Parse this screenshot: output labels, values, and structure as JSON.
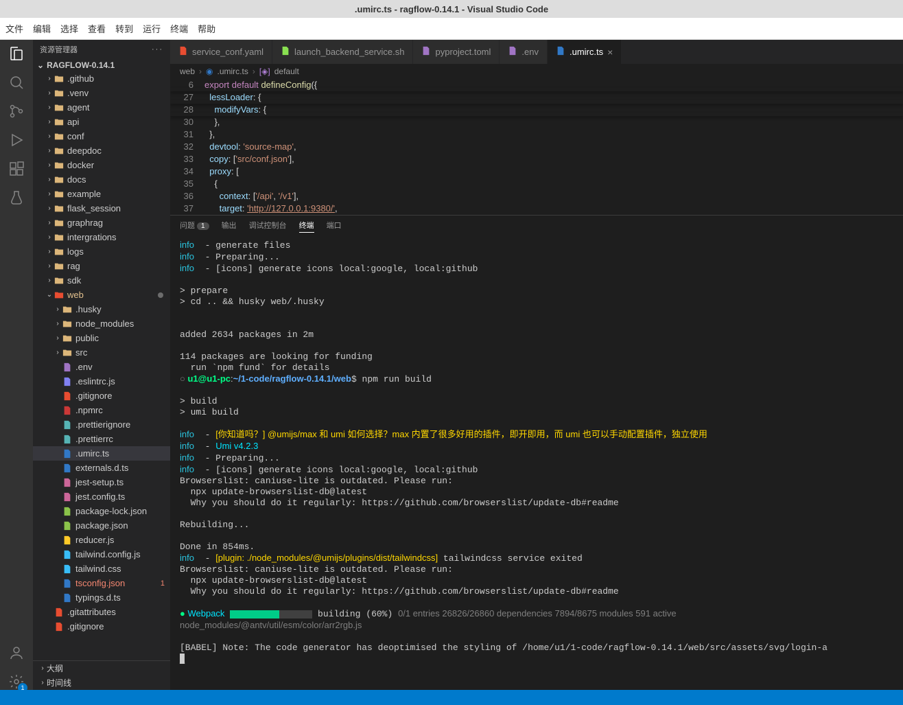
{
  "title": ".umirc.ts - ragflow-0.14.1 - Visual Studio Code",
  "menu": [
    "文件",
    "编辑",
    "选择",
    "查看",
    "转到",
    "运行",
    "终端",
    "帮助"
  ],
  "sidebar": {
    "title": "资源管理器",
    "root": "RAGFLOW-0.14.1",
    "folders": [
      ".github",
      ".venv",
      "agent",
      "api",
      "conf",
      "deepdoc",
      "docker",
      "docs",
      "example",
      "flask_session",
      "graphrag",
      "intergrations",
      "logs",
      "rag",
      "sdk"
    ],
    "web": "web",
    "webFolders": [
      ".husky",
      "node_modules",
      "public",
      "src"
    ],
    "webFiles": [
      {
        "n": ".env",
        "c": "#a074c4"
      },
      {
        "n": ".eslintrc.js",
        "c": "#8080f2"
      },
      {
        "n": ".gitignore",
        "c": "#e84d31"
      },
      {
        "n": ".npmrc",
        "c": "#cb3837"
      },
      {
        "n": ".prettierignore",
        "c": "#56b3b4"
      },
      {
        "n": ".prettierrc",
        "c": "#56b3b4"
      },
      {
        "n": ".umirc.ts",
        "c": "#3178c6",
        "sel": true
      },
      {
        "n": "externals.d.ts",
        "c": "#3178c6"
      },
      {
        "n": "jest-setup.ts",
        "c": "#cc6699"
      },
      {
        "n": "jest.config.ts",
        "c": "#cc6699"
      },
      {
        "n": "package-lock.json",
        "c": "#8bc34a"
      },
      {
        "n": "package.json",
        "c": "#8bc34a"
      },
      {
        "n": "reducer.js",
        "c": "#ffca28"
      },
      {
        "n": "tailwind.config.js",
        "c": "#38bdf8"
      },
      {
        "n": "tailwind.css",
        "c": "#38bdf8"
      },
      {
        "n": "tsconfig.json",
        "c": "#3178c6",
        "err": true,
        "badge": "1"
      },
      {
        "n": "typings.d.ts",
        "c": "#3178c6"
      }
    ],
    "rootFiles": [
      {
        "n": ".gitattributes",
        "c": "#e84d31"
      },
      {
        "n": ".gitignore",
        "c": "#e84d31"
      }
    ],
    "outline": "大纲",
    "timeline": "时间线"
  },
  "tabs": [
    {
      "n": "service_conf.yaml",
      "c": "#e84d31"
    },
    {
      "n": "launch_backend_service.sh",
      "c": "#89e051"
    },
    {
      "n": "pyproject.toml",
      "c": "#a074c4"
    },
    {
      "n": ".env",
      "c": "#a074c4"
    },
    {
      "n": ".umirc.ts",
      "c": "#3178c6",
      "active": true
    }
  ],
  "breadcrumb": {
    "a": "web",
    "b": ".umirc.ts",
    "c": "default"
  },
  "code": [
    {
      "n": 6,
      "t": "export default defineConfig({",
      "cls": "l6"
    },
    {
      "n": 27,
      "t": "  lessLoader: {",
      "cls": "l27"
    },
    {
      "n": 28,
      "t": "    modifyVars: {",
      "cls": "l28"
    },
    {
      "n": 30,
      "t": "    },",
      "cls": "pun"
    },
    {
      "n": 31,
      "t": "  },",
      "cls": "pun"
    },
    {
      "n": 32,
      "t": "  devtool: 'source-map',",
      "cls": "l32"
    },
    {
      "n": 33,
      "t": "  copy: ['src/conf.json'],",
      "cls": "l33"
    },
    {
      "n": 34,
      "t": "  proxy: [",
      "cls": "l34"
    },
    {
      "n": 35,
      "t": "    {",
      "cls": "pun"
    },
    {
      "n": 36,
      "t": "      context: ['/api', '/v1'],",
      "cls": "l36"
    },
    {
      "n": 37,
      "t": "      target: 'http://127.0.0.1:9380/',",
      "cls": "l37"
    }
  ],
  "panel": {
    "tabs": {
      "problems": "问题",
      "count": "1",
      "output": "输出",
      "debug": "调试控制台",
      "terminal": "终端",
      "ports": "端口"
    }
  },
  "term": {
    "l1": "info  - generate files",
    "l2": "info  - Preparing...",
    "l3": "info  - [icons] generate icons local:google, local:github",
    "l4": "> prepare",
    "l5": "> cd .. && husky web/.husky",
    "l6": "added 2634 packages in 2m",
    "l7": "114 packages are looking for funding",
    "l8": "  run `npm fund` for details",
    "prompt": {
      "user": "u1@u1-pc",
      "sep": ":",
      "path": "~/1-code/ragflow-0.14.1/web",
      "cmd": "$ npm run build"
    },
    "l9": "> build",
    "l10": "> umi build",
    "l11": "info  - [你知道吗？] @umijs/max 和 umi 如何选择？max 内置了很多好用的插件，即开即用，而 umi 也可以手动配置插件，独立使用",
    "l12": "info  - Umi v4.2.3",
    "l13": "info  - Preparing...",
    "l14": "info  - [icons] generate icons local:google, local:github",
    "l15": "Browserslist: caniuse-lite is outdated. Please run:",
    "l16": "  npx update-browserslist-db@latest",
    "l17": "  Why you should do it regularly: https://github.com/browserslist/update-db#readme",
    "l18": "Rebuilding...",
    "l19": "Done in 854ms.",
    "l20": "info  - [plugin: ./node_modules/@umijs/plugins/dist/tailwindcss] tailwindcss service exited",
    "l21": "Browserslist: caniuse-lite is outdated. Please run:",
    "l22": "  npx update-browserslist-db@latest",
    "l23": "  Why you should do it regularly: https://github.com/browserslist/update-db#readme",
    "wp": {
      "label": "Webpack",
      "pct": 60,
      "status": " building (60%) ",
      "detail": "0/1 entries 26826/26860 dependencies 7894/8675 modules 591 active",
      "path": "node_modules/@antv/util/esm/color/arr2rgb.js"
    },
    "babel": "[BABEL] Note: The code generator has deoptimised the styling of /home/u1/1-code/ragflow-0.14.1/web/src/assets/svg/login-a"
  }
}
